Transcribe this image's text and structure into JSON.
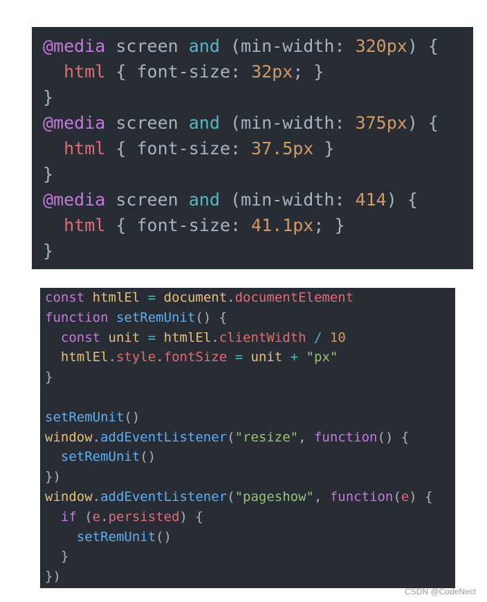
{
  "colors": {
    "background": "#282c34",
    "keyword": "#c678dd",
    "tag": "#e06c75",
    "function": "#61afef",
    "string": "#98c379",
    "number": "#d19a66",
    "operator": "#56b6c2",
    "punct": "#abb2bf",
    "plain": "#e5c07b",
    "text": "#abb2bf"
  },
  "css_block": {
    "lines": [
      [
        [
          "@media",
          "keyword"
        ],
        [
          " screen ",
          "text"
        ],
        [
          "and",
          "operator"
        ],
        [
          " (min-width: ",
          "text"
        ],
        [
          "320px",
          "number"
        ],
        [
          ") {",
          "text"
        ]
      ],
      [
        [
          "  ",
          "ws"
        ],
        [
          "html",
          "tag"
        ],
        [
          " { font-size: ",
          "text"
        ],
        [
          "32px",
          "number"
        ],
        [
          "; }",
          "text"
        ]
      ],
      [
        [
          "}",
          "text"
        ]
      ],
      [
        [
          "@media",
          "keyword"
        ],
        [
          " screen ",
          "text"
        ],
        [
          "and",
          "operator"
        ],
        [
          " (min-width: ",
          "text"
        ],
        [
          "375px",
          "number"
        ],
        [
          ") {",
          "text"
        ]
      ],
      [
        [
          "  ",
          "ws"
        ],
        [
          "html",
          "tag"
        ],
        [
          " { font-size: ",
          "text"
        ],
        [
          "37.5px",
          "number"
        ],
        [
          " }",
          "text"
        ]
      ],
      [
        [
          "}",
          "text"
        ]
      ],
      [
        [
          "@media",
          "keyword"
        ],
        [
          " screen ",
          "text"
        ],
        [
          "and",
          "operator"
        ],
        [
          " (min-width: ",
          "text"
        ],
        [
          "414",
          "number"
        ],
        [
          ") {",
          "text"
        ]
      ],
      [
        [
          "  ",
          "ws"
        ],
        [
          "html",
          "tag"
        ],
        [
          " { font-size: ",
          "text"
        ],
        [
          "41.1px",
          "number"
        ],
        [
          "; }",
          "text"
        ]
      ],
      [
        [
          "}",
          "text"
        ]
      ]
    ]
  },
  "js_block": {
    "lines": [
      [
        [
          "const",
          "keyword"
        ],
        [
          " ",
          "text"
        ],
        [
          "htmlEl",
          "plain"
        ],
        [
          " = ",
          "operator"
        ],
        [
          "document",
          "plain"
        ],
        [
          ".",
          "text"
        ],
        [
          "documentElement",
          "tag"
        ]
      ],
      [
        [
          "function",
          "keyword"
        ],
        [
          " ",
          "text"
        ],
        [
          "setRemUnit",
          "function"
        ],
        [
          "() {",
          "text"
        ]
      ],
      [
        [
          "  ",
          "ws"
        ],
        [
          "const",
          "keyword"
        ],
        [
          " ",
          "text"
        ],
        [
          "unit",
          "plain"
        ],
        [
          " = ",
          "operator"
        ],
        [
          "htmlEl",
          "plain"
        ],
        [
          ".",
          "text"
        ],
        [
          "clientWidth",
          "tag"
        ],
        [
          " / ",
          "operator"
        ],
        [
          "10",
          "number"
        ]
      ],
      [
        [
          "  ",
          "ws"
        ],
        [
          "htmlEl",
          "plain"
        ],
        [
          ".",
          "text"
        ],
        [
          "style",
          "tag"
        ],
        [
          ".",
          "text"
        ],
        [
          "fontSize",
          "tag"
        ],
        [
          " = ",
          "operator"
        ],
        [
          "unit",
          "plain"
        ],
        [
          " + ",
          "operator"
        ],
        [
          "\"px\"",
          "string"
        ]
      ],
      [
        [
          "}",
          "text"
        ]
      ],
      [
        [
          "",
          "text"
        ]
      ],
      [
        [
          "setRemUnit",
          "function"
        ],
        [
          "()",
          "text"
        ]
      ],
      [
        [
          "window",
          "plain"
        ],
        [
          ".",
          "text"
        ],
        [
          "addEventListener",
          "function"
        ],
        [
          "(",
          "text"
        ],
        [
          "\"resize\"",
          "string"
        ],
        [
          ", ",
          "text"
        ],
        [
          "function",
          "keyword"
        ],
        [
          "() {",
          "text"
        ]
      ],
      [
        [
          "  ",
          "ws"
        ],
        [
          "setRemUnit",
          "function"
        ],
        [
          "()",
          "text"
        ]
      ],
      [
        [
          "})",
          "text"
        ]
      ],
      [
        [
          "window",
          "plain"
        ],
        [
          ".",
          "text"
        ],
        [
          "addEventListener",
          "function"
        ],
        [
          "(",
          "text"
        ],
        [
          "\"pageshow\"",
          "string"
        ],
        [
          ", ",
          "text"
        ],
        [
          "function",
          "keyword"
        ],
        [
          "(",
          "text"
        ],
        [
          "e",
          "tag"
        ],
        [
          ") {",
          "text"
        ]
      ],
      [
        [
          "  ",
          "ws"
        ],
        [
          "if",
          "keyword"
        ],
        [
          " (",
          "text"
        ],
        [
          "e",
          "tag"
        ],
        [
          ".",
          "text"
        ],
        [
          "persisted",
          "tag"
        ],
        [
          ") {",
          "text"
        ]
      ],
      [
        [
          "    ",
          "ws"
        ],
        [
          "setRemUnit",
          "function"
        ],
        [
          "()",
          "text"
        ]
      ],
      [
        [
          "  ",
          "ws"
        ],
        [
          "}",
          "text"
        ]
      ],
      [
        [
          "})",
          "text"
        ]
      ]
    ]
  },
  "watermark": "CSDN @CodeNect"
}
